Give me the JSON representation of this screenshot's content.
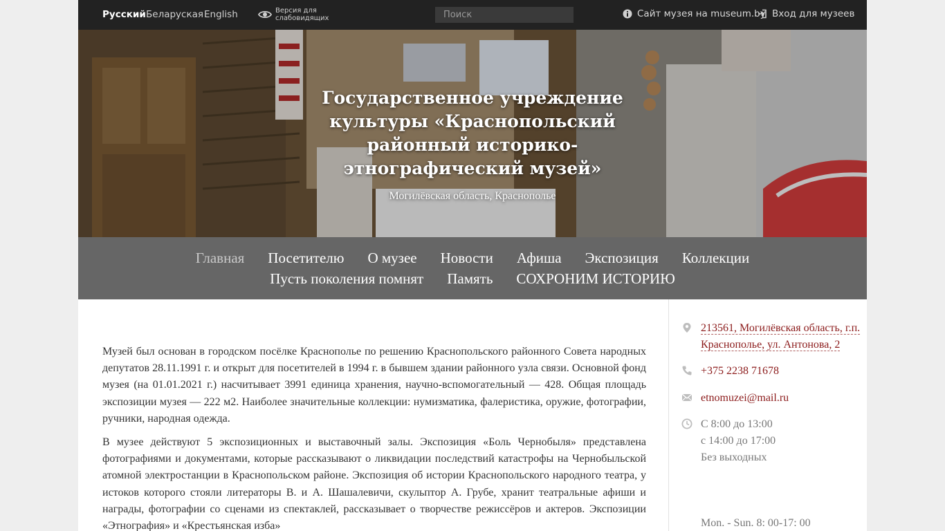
{
  "topbar": {
    "languages": [
      "Русский",
      "Беларуская",
      "English"
    ],
    "low_vision": "Версия для слабовидящих",
    "search_placeholder": "Поиск",
    "museum_site": "Сайт музея на museum.by",
    "login": "Вход для музеев"
  },
  "hero": {
    "title": "Государственное учреждение культуры «Краснопольский районный историко-этнографический музей»",
    "subtitle": "Могилёвская область, Краснополье"
  },
  "nav": {
    "row1": [
      "Главная",
      "Посетителю",
      "О музее",
      "Новости",
      "Афиша",
      "Экспозиция",
      "Коллекции"
    ],
    "row2": [
      "Пусть поколения помнят",
      "Память",
      "СОХРОНИМ ИСТОРИЮ"
    ]
  },
  "content": {
    "paragraphs": [
      "Музей был основан в городском посёлке Краснополье по решению Краснопольского районного Совета народных депутатов 28.11.1991 г. и открыт для посетителей в 1994 г. в бывшем здании районного узла связи. Основной фонд музея (на 01.01.2021 г.) насчитывает 3991 единица хранения, научно-вспомогательный — 428. Общая площадь экспозиции музея — 222 м2. Наиболее значительные коллекции: нумизматика, фалеристика, оружие, фотографии, ручники, народная одежда.",
      "В музее действуют 5 экспозиционных и выставочный залы. Экспозиция «Боль Чернобыля» представлена фотографиями и документами, которые рассказывают о ликвидации последствий катастрофы на Чернобыльской атомной электростанции в Краснопольском районе. Экспозиция об истории Краснопольского народного театра, у истоков которого стояли литераторы В. и А. Шашалевичи, скульптор А. Грубе, хранит театральные афиши и награды, фотографии со сценами из спектаклей, рассказывает о творчестве режиссёров и актеров. Экспозиции «Этнография» и «Крестьянская изба»"
    ]
  },
  "sidebar": {
    "address": "213561, Могилёвская область, г.п. Краснополье, ул. Антонова, 2",
    "phone": "+375 2238 71678",
    "email": "etnomuzei@mail.ru",
    "hours": [
      "С 8:00 до 13:00",
      "с 14:00 до 17:00",
      "Без выходных"
    ],
    "hours_en": "Mon. - Sun. 8: 00-17: 00"
  },
  "colors": {
    "topbar_bg": "#222222",
    "nav_bg": "#666666",
    "link": "#8b1a1a"
  }
}
